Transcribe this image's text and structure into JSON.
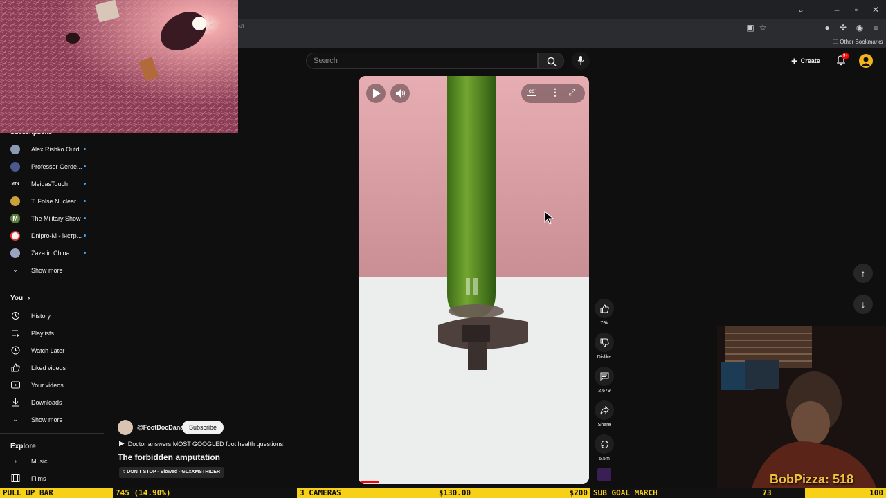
{
  "browser": {
    "url_fragment": "s8",
    "bookmarks_label": "Other Bookmarks"
  },
  "youtube": {
    "search_placeholder": "Search",
    "create_label": "Create",
    "notification_count": "9+"
  },
  "sidebar": {
    "subscriptions_title": "Subscriptions",
    "subscriptions": [
      {
        "label": "Alex Rishko Outd..."
      },
      {
        "label": "Professor Gerde..."
      },
      {
        "label": "MeidasTouch"
      },
      {
        "label": "T. Folse Nuclear"
      },
      {
        "label": "The Military Show"
      },
      {
        "label": "Dnipro-M - інстр..."
      },
      {
        "label": "Zaza in China"
      }
    ],
    "show_more_1": "Show more",
    "you_title": "You",
    "you_items": [
      {
        "label": "History",
        "icon": "history-icon"
      },
      {
        "label": "Playlists",
        "icon": "playlists-icon"
      },
      {
        "label": "Watch Later",
        "icon": "clock-icon"
      },
      {
        "label": "Liked videos",
        "icon": "thumb-up-icon"
      },
      {
        "label": "Your videos",
        "icon": "play-icon"
      },
      {
        "label": "Downloads",
        "icon": "download-icon"
      }
    ],
    "show_more_2": "Show more",
    "explore_title": "Explore",
    "explore_items": [
      {
        "label": "Music",
        "icon": "music-icon"
      },
      {
        "label": "Films",
        "icon": "film-icon"
      }
    ]
  },
  "short": {
    "channel": "@FootDocDana",
    "subscribe_label": "Subscribe",
    "related": "Doctor answers MOST GOOGLED foot health questions!",
    "title": "The forbidden amputation",
    "music": "DON'T STOP - Slowed - GLXXMSTRIDER",
    "likes": "79k",
    "dislike_label": "Dislike",
    "comments": "2,679",
    "share_label": "Share",
    "remix": "6.5m"
  },
  "stream": {
    "overlay_name": "BobPizza: 518",
    "ticker": [
      "PULL UP BAR",
      "745 (14.90%)",
      "3 CAMERAS",
      "$130.00",
      "$200",
      "SUB GOAL MARCH",
      "73",
      "100"
    ]
  },
  "colors": {
    "accent_red": "#ff0000",
    "ticker_yellow": "#f7d117",
    "overlay_gold": "#f3c23c"
  }
}
